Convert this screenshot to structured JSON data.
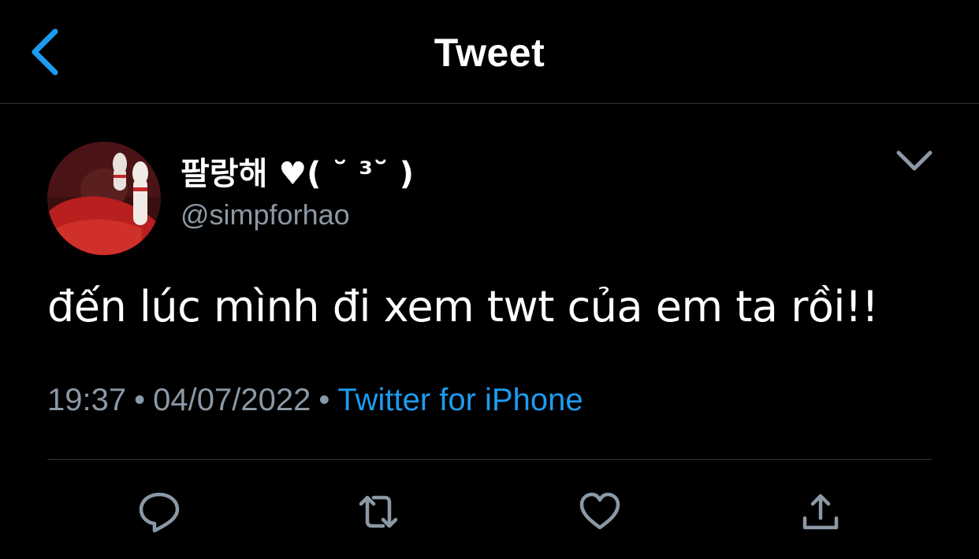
{
  "header": {
    "title": "Tweet",
    "back_icon": "chevron-left-icon"
  },
  "colors": {
    "background": "#000000",
    "text_primary": "#ffffff",
    "text_secondary": "#8b98a5",
    "accent": "#1d9bf0",
    "icon_gray": "#8b98a5",
    "divider": "#2f3336"
  },
  "tweet": {
    "author": {
      "display_name": "팔랑해 ♥( ˘ ³˘ )",
      "handle": "@simpforhao"
    },
    "text": "đến lúc mình đi xem twt của em ta rồi!!",
    "time": "19:37",
    "separator": "•",
    "date": "04/07/2022",
    "source": "Twitter for iPhone"
  },
  "actions": [
    {
      "name": "reply",
      "icon": "reply-icon"
    },
    {
      "name": "retweet",
      "icon": "retweet-icon"
    },
    {
      "name": "like",
      "icon": "heart-icon"
    },
    {
      "name": "share",
      "icon": "share-icon"
    }
  ]
}
